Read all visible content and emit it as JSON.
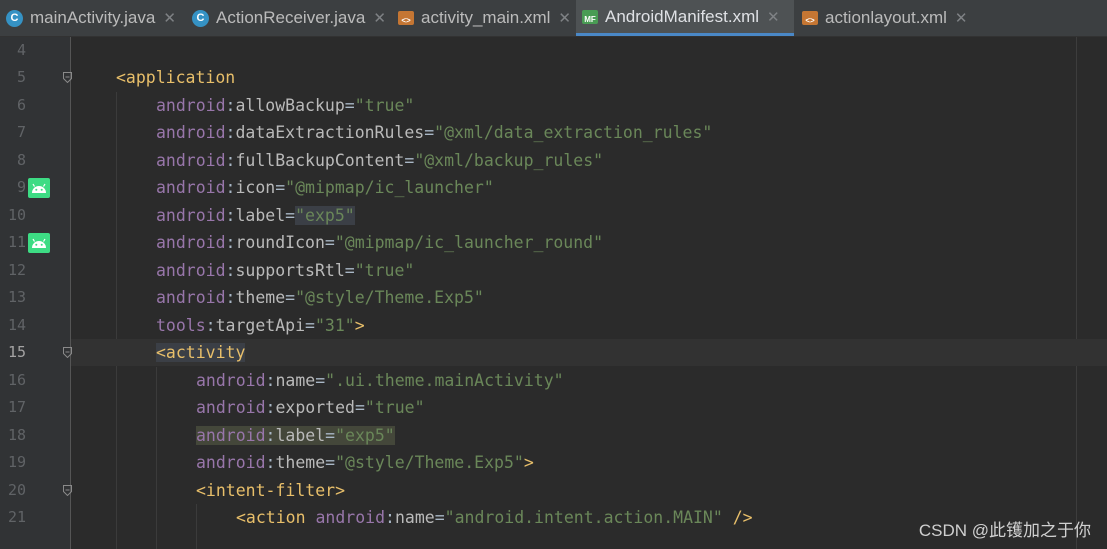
{
  "tabs": [
    {
      "label": "mainActivity.java",
      "icon": "java-class-icon",
      "active": false
    },
    {
      "label": "ActionReceiver.java",
      "icon": "java-class-icon",
      "active": false
    },
    {
      "label": "activity_main.xml",
      "icon": "xml-layout-icon",
      "active": false
    },
    {
      "label": "AndroidManifest.xml",
      "icon": "manifest-file-icon",
      "active": true
    },
    {
      "label": "actionlayout.xml",
      "icon": "xml-layout-icon",
      "active": false
    }
  ],
  "tab_glyphs": {
    "close": "✕",
    "java": "C",
    "xml": "<>",
    "mf": "MF"
  },
  "line_numbers": [
    "4",
    "5",
    "6",
    "7",
    "8",
    "9",
    "10",
    "11",
    "12",
    "13",
    "14",
    "15",
    "16",
    "17",
    "18",
    "19",
    "20",
    "21"
  ],
  "current_line": "15",
  "code": {
    "l5": {
      "tag": "<application"
    },
    "l6": {
      "ns": "android",
      "colon": ":",
      "attr": "allowBackup",
      "eq": "=",
      "val": "\"true\""
    },
    "l7": {
      "ns": "android",
      "colon": ":",
      "attr": "dataExtractionRules",
      "eq": "=",
      "val": "\"@xml/data_extraction_rules\""
    },
    "l8": {
      "ns": "android",
      "colon": ":",
      "attr": "fullBackupContent",
      "eq": "=",
      "val": "\"@xml/backup_rules\""
    },
    "l9": {
      "ns": "android",
      "colon": ":",
      "attr": "icon",
      "eq": "=",
      "val": "\"@mipmap/ic_launcher\""
    },
    "l10": {
      "ns": "android",
      "colon": ":",
      "attr": "label",
      "eq": "=",
      "val": "\"exp5\""
    },
    "l11": {
      "ns": "android",
      "colon": ":",
      "attr": "roundIcon",
      "eq": "=",
      "val": "\"@mipmap/ic_launcher_round\""
    },
    "l12": {
      "ns": "android",
      "colon": ":",
      "attr": "supportsRtl",
      "eq": "=",
      "val": "\"true\""
    },
    "l13": {
      "ns": "android",
      "colon": ":",
      "attr": "theme",
      "eq": "=",
      "val": "\"@style/Theme.Exp5\""
    },
    "l14": {
      "ns": "tools",
      "colon": ":",
      "attr": "targetApi",
      "eq": "=",
      "val": "\"31\"",
      "end": ">"
    },
    "l15": {
      "tag": "<activity"
    },
    "l16": {
      "ns": "android",
      "colon": ":",
      "attr": "name",
      "eq": "=",
      "val": "\".ui.theme.mainActivity\""
    },
    "l17": {
      "ns": "android",
      "colon": ":",
      "attr": "exported",
      "eq": "=",
      "val": "\"true\""
    },
    "l18": {
      "ns": "android",
      "colon": ":",
      "attr": "label",
      "eq": "=",
      "val": "\"exp5\""
    },
    "l19": {
      "ns": "android",
      "colon": ":",
      "attr": "theme",
      "eq": "=",
      "val": "\"@style/Theme.Exp5\"",
      "end": ">"
    },
    "l20": {
      "tag": "<intent-filter>"
    },
    "l21": {
      "tag": "<action",
      "ns": "android",
      "colon": ":",
      "attr": "name",
      "eq": "=",
      "val": "\"android.intent.action.MAIN\"",
      "end": " />"
    }
  },
  "watermark": "CSDN @此镬加之于你",
  "colors": {
    "tag": "#e8bf6a",
    "namespace": "#9876aa",
    "attribute": "#bababa",
    "string": "#6a8759",
    "accent": "#4a88c7",
    "android_green": "#3ddc84"
  }
}
